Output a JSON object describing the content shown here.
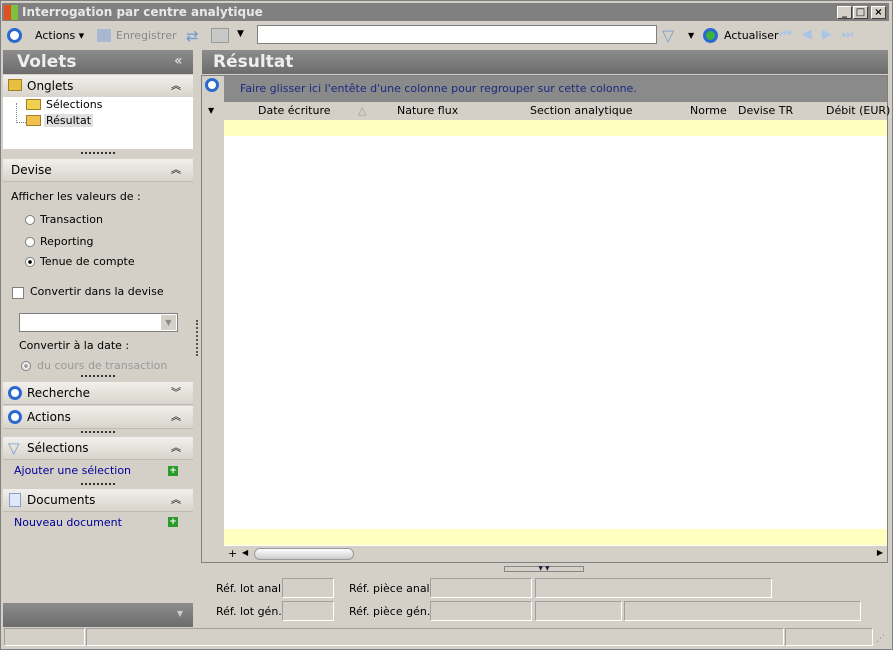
{
  "window": {
    "title": "Interrogation par centre analytique"
  },
  "toolbar": {
    "actions": "Actions",
    "save": "Enregistrer",
    "search_value": "",
    "refresh": "Actualiser"
  },
  "left": {
    "title": "Volets",
    "onglets": {
      "title": "Onglets",
      "items": [
        "Sélections",
        "Résultat"
      ]
    },
    "devise": {
      "title": "Devise",
      "prompt": "Afficher les valeurs de :",
      "options": [
        "Transaction",
        "Reporting",
        "Tenue de compte"
      ],
      "selected": "Tenue de compte",
      "convert": "Convertir dans la devise",
      "date_label": "Convertir à la date :",
      "date_option": "du cours de transaction"
    },
    "recherche": "Recherche",
    "actions": "Actions",
    "selections": {
      "title": "Sélections",
      "link": "Ajouter une sélection"
    },
    "documents": {
      "title": "Documents",
      "link": "Nouveau document"
    }
  },
  "main": {
    "title": "Résultat",
    "group_hint": "Faire glisser ici l'entête d'une colonne pour regrouper sur cette colonne.",
    "columns": [
      "Date écriture",
      "Nature flux",
      "Section analytique",
      "Norme",
      "Devise TR",
      "Débit (EUR)"
    ]
  },
  "footer": {
    "lot_anal": "Réf. lot  anal.",
    "lot_gen": "Réf. lot gén.",
    "piece_anal": "Réf. pièce anal.",
    "piece_gen": "Réf. pièce gén."
  }
}
